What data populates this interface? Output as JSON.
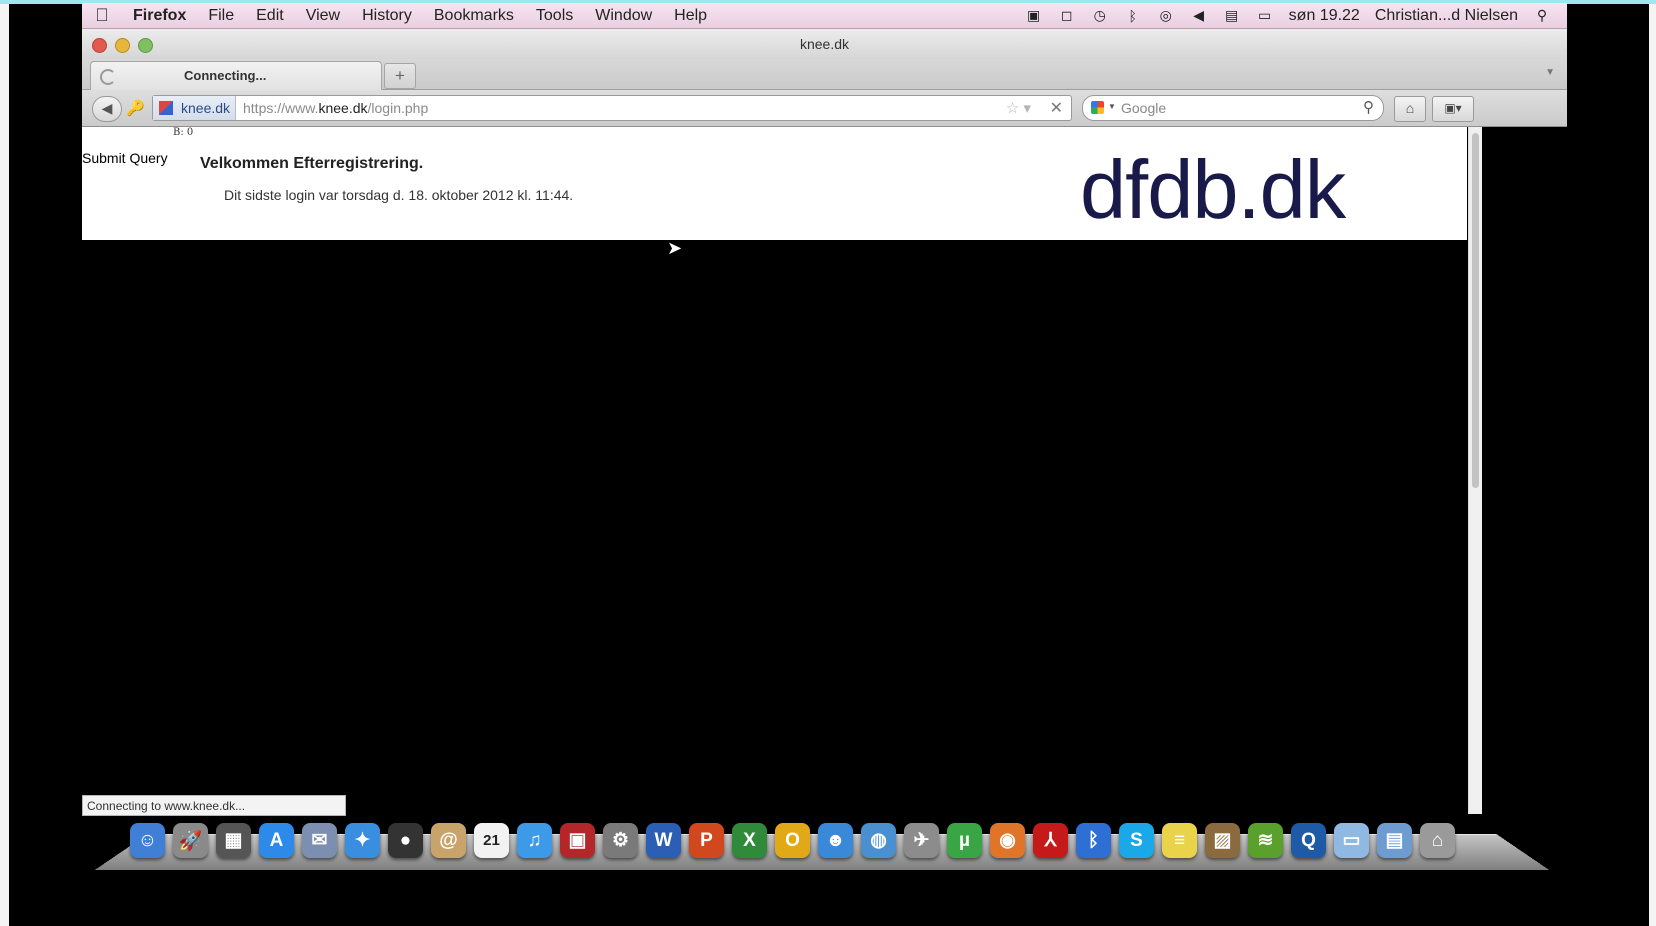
{
  "menubar": {
    "app_name": "Firefox",
    "items": [
      "File",
      "Edit",
      "View",
      "History",
      "Bookmarks",
      "Tools",
      "Window",
      "Help"
    ],
    "clock": "søn 19.22",
    "user": "Christian...d Nielsen"
  },
  "window": {
    "title": "knee.dk"
  },
  "tabs": [
    {
      "label": "Connecting..."
    }
  ],
  "new_tab_label": "+",
  "urlbar": {
    "site_identity": "knee.dk",
    "url_prefix": "https://www.",
    "url_domain": "knee.dk",
    "url_path": "/login.php"
  },
  "search": {
    "placeholder": "Google"
  },
  "page": {
    "tiny_text": "B: 0",
    "submit_button": "Submit Query",
    "welcome_heading": "Velkommen Efterregistrering.",
    "last_login": "Dit sidste login var torsdag d. 18. oktober 2012 kl. 11:44.",
    "logo_text": "dfdb.dk"
  },
  "status_bar": "Connecting to www.knee.dk...",
  "dock": {
    "calendar_day": "21",
    "items": [
      {
        "name": "finder-icon",
        "glyph": "☺",
        "color": "#3f7fd6"
      },
      {
        "name": "launchpad-icon",
        "glyph": "🚀",
        "color": "#8a8a8a"
      },
      {
        "name": "mission-control-icon",
        "glyph": "▦",
        "color": "#555"
      },
      {
        "name": "app-store-icon",
        "glyph": "A",
        "color": "#2d8ae8"
      },
      {
        "name": "mail-icon",
        "glyph": "✉",
        "color": "#7d8fb0"
      },
      {
        "name": "safari-icon",
        "glyph": "✦",
        "color": "#3a8ee0"
      },
      {
        "name": "facetime-icon",
        "glyph": "●",
        "color": "#333"
      },
      {
        "name": "contacts-icon",
        "glyph": "@",
        "color": "#c8a46a"
      },
      {
        "name": "calendar-icon",
        "glyph": "21",
        "color": "#f2f2f2"
      },
      {
        "name": "itunes-icon",
        "glyph": "♫",
        "color": "#3d9ae8"
      },
      {
        "name": "photo-booth-icon",
        "glyph": "▣",
        "color": "#b3262a"
      },
      {
        "name": "system-preferences-icon",
        "glyph": "⚙",
        "color": "#7a7a7a"
      },
      {
        "name": "word-icon",
        "glyph": "W",
        "color": "#2a5fb5"
      },
      {
        "name": "powerpoint-icon",
        "glyph": "P",
        "color": "#d2481e"
      },
      {
        "name": "excel-icon",
        "glyph": "X",
        "color": "#2f8a3a"
      },
      {
        "name": "outlook-icon",
        "glyph": "O",
        "color": "#e1a818"
      },
      {
        "name": "messenger-icon",
        "glyph": "☻",
        "color": "#3a88d8"
      },
      {
        "name": "network-icon",
        "glyph": "◍",
        "color": "#4a8fd0"
      },
      {
        "name": "satellite-icon",
        "glyph": "✈",
        "color": "#8c8c8c"
      },
      {
        "name": "utorrent-icon",
        "glyph": "µ",
        "color": "#3aa544"
      },
      {
        "name": "firefox-icon",
        "glyph": "◉",
        "color": "#e0752a"
      },
      {
        "name": "acrobat-icon",
        "glyph": "⅄",
        "color": "#c41a1a"
      },
      {
        "name": "bluetooth-icon",
        "glyph": "ᛒ",
        "color": "#2d6fd3"
      },
      {
        "name": "skype-icon",
        "glyph": "S",
        "color": "#1aa8e8"
      },
      {
        "name": "stickies-icon",
        "glyph": "≡",
        "color": "#e8d34a"
      },
      {
        "name": "preview-icon",
        "glyph": "▨",
        "color": "#8a6a3e"
      },
      {
        "name": "spotify-icon",
        "glyph": "≋",
        "color": "#5aa02c"
      },
      {
        "name": "quicktime-icon",
        "glyph": "Q",
        "color": "#1e5aa5"
      },
      {
        "name": "folder-icon",
        "glyph": "▭",
        "color": "#8fb8e3"
      },
      {
        "name": "documents-icon",
        "glyph": "▤",
        "color": "#6e9bd0"
      },
      {
        "name": "trash-icon",
        "glyph": "⌂",
        "color": "#9a9a9a"
      }
    ]
  }
}
